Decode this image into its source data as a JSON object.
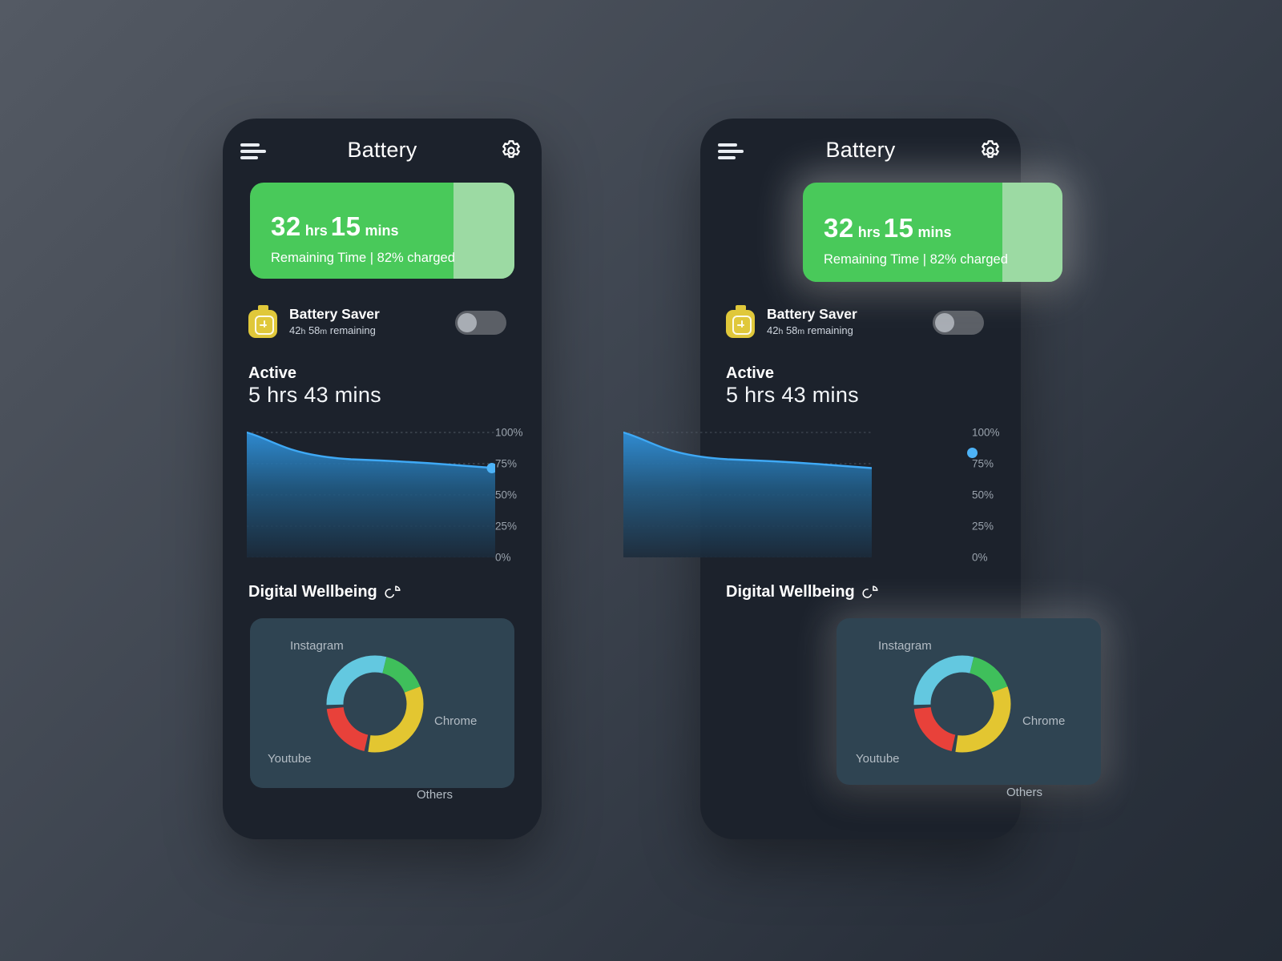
{
  "app": {
    "title": "Battery",
    "menu_icon": "hamburger-icon",
    "settings_icon": "gear-icon"
  },
  "remaining_card": {
    "hours": "32",
    "hours_unit": "hrs",
    "minutes": "15",
    "minutes_unit": "mins",
    "subtitle": "Remaining Time | 82% charged",
    "charge_percent": 82,
    "fill_color": "#49c95a",
    "track_color": "#9cdaa3"
  },
  "battery_saver": {
    "label": "Battery Saver",
    "sub_value": "42",
    "sub_unit_h": "h",
    "sub_minutes": "58",
    "sub_unit_m": "m",
    "sub_suffix": "remaining",
    "sub_full": "42h 58m remaining",
    "icon": "battery-plus-icon",
    "toggle_state": "off",
    "icon_color": "#e0c83a"
  },
  "active": {
    "label": "Active",
    "value": "5 hrs 43 mins"
  },
  "digital_wellbeing": {
    "title": "Digital Wellbeing",
    "icon": "pie-chart-icon",
    "card_color": "#2f4452"
  },
  "chart_data": [
    {
      "type": "area",
      "title": "Battery level over time",
      "ylabel": "",
      "xlabel": "",
      "ylim": [
        0,
        100
      ],
      "yticks": [
        "0%",
        "25%",
        "50%",
        "75%",
        "100%"
      ],
      "ytick_values": [
        0,
        25,
        50,
        75,
        100
      ],
      "grid": true,
      "line_color": "#3aa6f0",
      "marker_value": 82,
      "x": [
        0,
        5,
        10,
        15,
        20,
        25,
        30,
        35,
        40,
        50,
        60,
        70,
        80,
        90,
        100
      ],
      "values": [
        100,
        97.5,
        95,
        93,
        91.4,
        90.2,
        89.2,
        88.5,
        88.1,
        87.4,
        86.8,
        86.1,
        85.2,
        84.0,
        82.6
      ]
    },
    {
      "type": "pie",
      "title": "Digital Wellbeing",
      "donut": true,
      "categories": [
        "Instagram",
        "Chrome",
        "Others",
        "Youtube"
      ],
      "values": [
        29,
        15,
        33,
        21
      ],
      "colors": [
        "#63c8e0",
        "#3fbf5b",
        "#e3c631",
        "#e8413a"
      ],
      "legend_position": "around",
      "labels": {
        "instagram": "Instagram",
        "chrome": "Chrome",
        "others": "Others",
        "youtube": "Youtube"
      }
    }
  ],
  "theme": {
    "phone_bg": "#1c222c",
    "page_bg_from": "#545a64",
    "page_bg_to": "#242b35",
    "accent_green": "#49c95a",
    "accent_blue": "#3aa6f0",
    "accent_yellow": "#e0c83a"
  }
}
